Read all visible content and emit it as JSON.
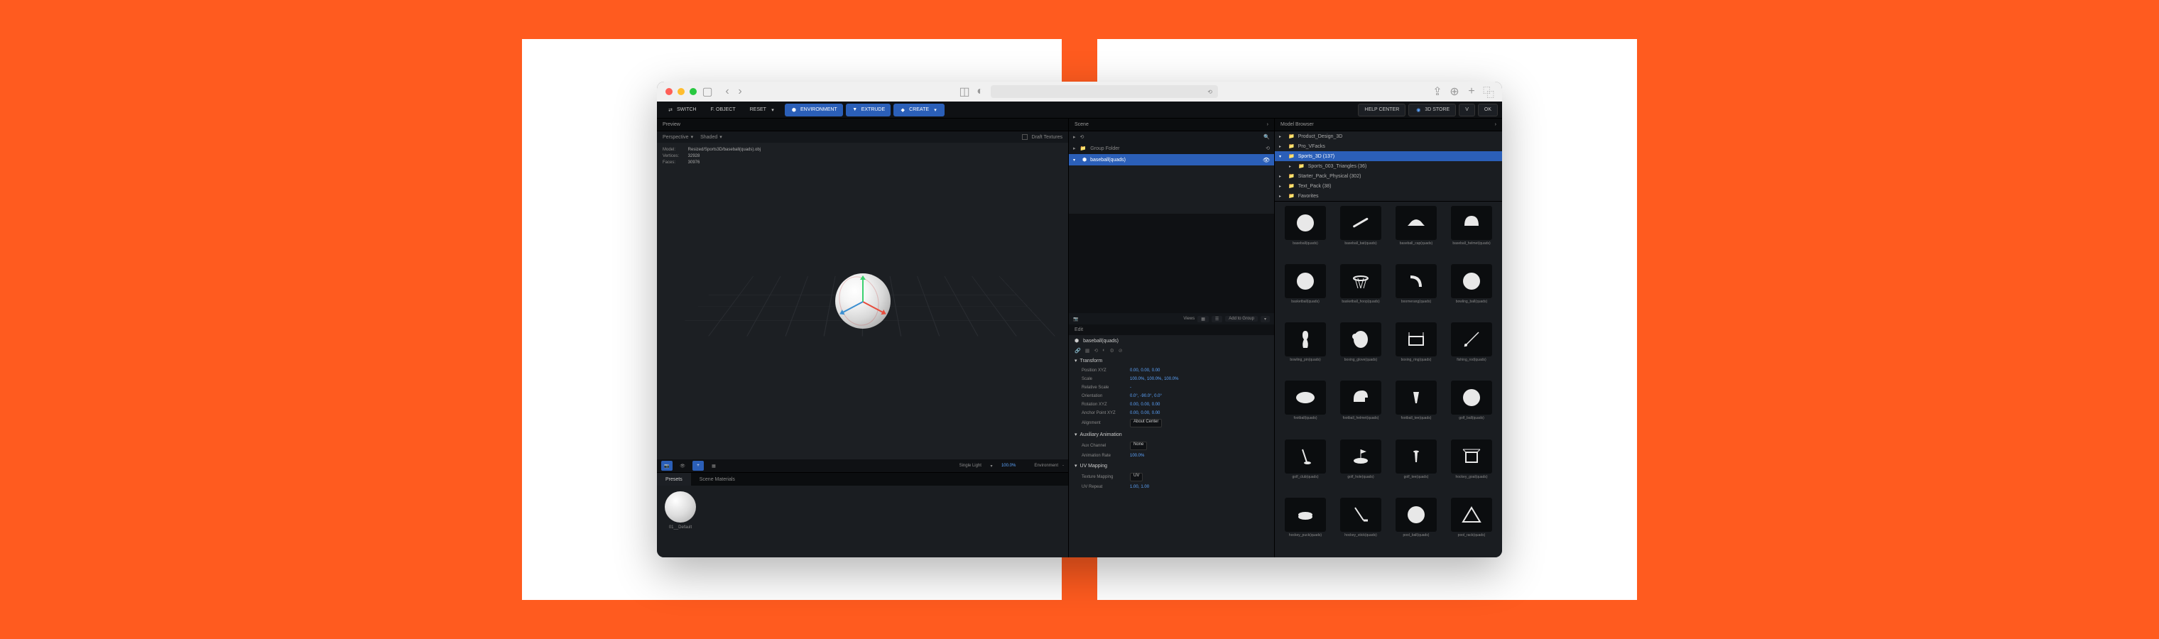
{
  "toolbar": {
    "switch": "SWITCH",
    "f_object": "F. OBJECT",
    "reset": "RESET",
    "environment": "ENVIRONMENT",
    "extrude": "EXTRUDE",
    "create": "CREATE",
    "help_center": "HELP CENTER",
    "store": "3D STORE",
    "v": "V",
    "ok": "OK"
  },
  "preview": {
    "panel_title": "Preview",
    "perspective": "Perspective",
    "shaded": "Shaded",
    "draft_textures": "Draft Textures",
    "model_label": "Model:",
    "model_value": "Resized/Sports3D/baseball(quads).obj",
    "vertices_label": "Vertices:",
    "vertices_value": "32928",
    "faces_label": "Faces:",
    "faces_value": "30976"
  },
  "vp_footer": {
    "single_light": "Single Light",
    "light_pct": "100.0%",
    "environment": "Environment",
    "env_val": "-"
  },
  "presets": {
    "tab_presets": "Presets",
    "tab_materials": "Scene Materials",
    "default_name": "01__Default"
  },
  "scene": {
    "panel_title": "Scene",
    "group_folder": "Group Folder",
    "item": "baseball(quads)"
  },
  "props_bar": {
    "views": "Views",
    "add_to_group": "Add to Group"
  },
  "edit": {
    "section": "Edit",
    "name": "baseball(quads)",
    "transform": "Transform",
    "position": {
      "lbl": "Position XYZ",
      "x": "0.00,",
      "y": "0.00,",
      "z": "0.00"
    },
    "scale": {
      "lbl": "Scale",
      "x": "100.0%,",
      "y": "100.0%,",
      "z": "100.0%"
    },
    "rel_scale": {
      "lbl": "Relative Scale",
      "val": "-"
    },
    "orientation": {
      "lbl": "Orientation",
      "x": "0.0°,",
      "y": "-90.0°,",
      "z": "0.0°"
    },
    "rotation": {
      "lbl": "Rotation XYZ",
      "x": "0.00,",
      "y": "0.00,",
      "z": "0.00"
    },
    "anchor": {
      "lbl": "Anchor Point XYZ",
      "x": "0.00,",
      "y": "0.00,",
      "z": "0.00"
    },
    "alignment": {
      "lbl": "Alignment",
      "val": "About Center"
    },
    "aux_animation": "Auxiliary Animation",
    "aux_channel": {
      "lbl": "Aux Channel",
      "val": "None"
    },
    "anim_rate": {
      "lbl": "Animation Rate",
      "val": "100.0%"
    },
    "uv_mapping": "UV Mapping",
    "texture_mapping": {
      "lbl": "Texture Mapping",
      "val": "UV"
    },
    "uv_repeat": {
      "lbl": "UV Repeat",
      "x": "1.00,",
      "y": "1.00"
    }
  },
  "model_browser": {
    "panel_title": "Model Browser",
    "tree": [
      {
        "name": "Product_Design_3D",
        "sel": false
      },
      {
        "name": "Pro_VFacks",
        "sel": false
      },
      {
        "name": "Sports_3D (137)",
        "sel": true,
        "expanded": true
      },
      {
        "name": "Sports_003_Triangles (36)",
        "sel": false,
        "child": true
      },
      {
        "name": "Starter_Pack_Physical (302)",
        "sel": false
      },
      {
        "name": "Text_Pack (38)",
        "sel": false
      },
      {
        "name": "Favorites",
        "sel": false
      }
    ],
    "items": [
      {
        "name": "baseball(quads)",
        "shape": "sphere"
      },
      {
        "name": "baseball_bat(quads)",
        "shape": "bat"
      },
      {
        "name": "baseball_cap(quads)",
        "shape": "cap"
      },
      {
        "name": "baseball_helmet(quads)",
        "shape": "helmet"
      },
      {
        "name": "basketball(quads)",
        "shape": "sphere"
      },
      {
        "name": "basketball_hoop(quads)",
        "shape": "hoop"
      },
      {
        "name": "boomerang(quads)",
        "shape": "boomerang"
      },
      {
        "name": "bowling_ball(quads)",
        "shape": "sphere"
      },
      {
        "name": "bowling_pin(quads)",
        "shape": "pin"
      },
      {
        "name": "boxing_glove(quads)",
        "shape": "glove"
      },
      {
        "name": "boxing_ring(quads)",
        "shape": "ring"
      },
      {
        "name": "fishing_rod(quads)",
        "shape": "rod"
      },
      {
        "name": "football(quads)",
        "shape": "football"
      },
      {
        "name": "football_helmet(quads)",
        "shape": "helmet2"
      },
      {
        "name": "football_tee(quads)",
        "shape": "tee"
      },
      {
        "name": "golf_ball(quads)",
        "shape": "sphere"
      },
      {
        "name": "golf_club(quads)",
        "shape": "club"
      },
      {
        "name": "golf_hole(quads)",
        "shape": "hole"
      },
      {
        "name": "golf_tee(quads)",
        "shape": "tee2"
      },
      {
        "name": "hockey_goal(quads)",
        "shape": "goal"
      },
      {
        "name": "hockey_puck(quads)",
        "shape": "puck"
      },
      {
        "name": "hockey_stick(quads)",
        "shape": "stick"
      },
      {
        "name": "pool_ball(quads)",
        "shape": "sphere"
      },
      {
        "name": "pool_rack(quads)",
        "shape": "rack"
      }
    ]
  }
}
